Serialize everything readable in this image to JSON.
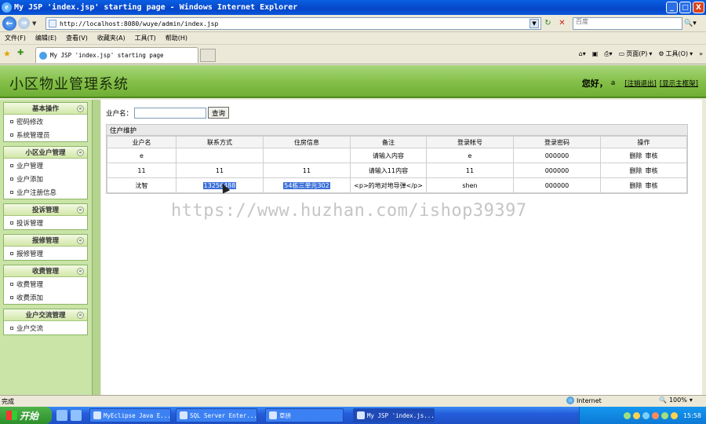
{
  "window": {
    "title": "My JSP 'index.jsp' starting page - Windows Internet Explorer",
    "buttons": [
      "_",
      "□",
      "X"
    ]
  },
  "address": {
    "url": "http://localhost:8080/wuye/admin/index.jsp",
    "search_placeholder": "百度"
  },
  "menu": [
    "文件(F)",
    "编辑(E)",
    "查看(V)",
    "收藏夹(A)",
    "工具(T)",
    "帮助(H)"
  ],
  "tab": {
    "label": "My JSP 'index.jsp' starting page"
  },
  "commands": {
    "page_label": "页面(P)",
    "tools_label": "工具(O)"
  },
  "banner": {
    "title": "小区物业管理系统",
    "greeting": "您好，",
    "user": "a",
    "logout": "[注销退出]",
    "home": "[显示主框架]"
  },
  "sidebar": {
    "groups": [
      {
        "title": "基本操作",
        "items": [
          "密码修改",
          "系统管理员"
        ]
      },
      {
        "title": "小区业户管理",
        "items": [
          "业户管理",
          "业户添加",
          "业户注册信息"
        ]
      },
      {
        "title": "投诉管理",
        "items": [
          "投诉管理"
        ]
      },
      {
        "title": "报修管理",
        "items": [
          "报修管理"
        ]
      },
      {
        "title": "收费管理",
        "items": [
          "收费管理",
          "收费添加"
        ]
      },
      {
        "title": "业户交流管理",
        "items": [
          "业户交流"
        ]
      }
    ]
  },
  "search": {
    "label": "业户名：",
    "button": "查询"
  },
  "panel": {
    "title": "住户维护"
  },
  "table": {
    "headers": [
      "业户名",
      "联系方式",
      "住房信息",
      "备注",
      "登录帐号",
      "登录密码",
      "操作"
    ],
    "rows": [
      [
        "e",
        "",
        "",
        "请输入内容",
        "e",
        "000000"
      ],
      [
        "11",
        "11",
        "11",
        "请输入11内容",
        "11",
        "000000"
      ],
      [
        "沈智",
        "13256488",
        "54栋三单元302",
        "<p>的地对地导弹</p>",
        "shen",
        "000000"
      ]
    ],
    "actions": [
      "删除",
      "审核"
    ]
  },
  "watermark": "https://www.huzhan.com/ishop39397",
  "status": {
    "text": "完成",
    "zone": "Internet",
    "zoom": "100%"
  },
  "taskbar": {
    "start": "开始",
    "tasks": [
      "MyEclipse Java E...",
      "SQL Server Enter...",
      "草拼",
      "My JSP 'index.js..."
    ],
    "clock": "15:58"
  }
}
